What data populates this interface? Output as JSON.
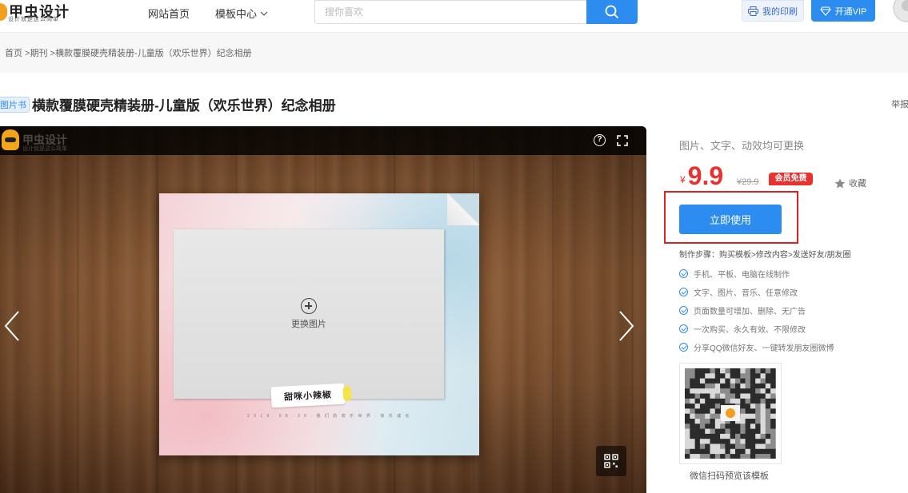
{
  "header": {
    "logo_text": "甲虫设计",
    "logo_sub": "设计就是这么简单",
    "nav_home": "网站首页",
    "nav_templates": "模板中心",
    "search_placeholder": "搜你喜欢",
    "print_label": "我的印刷",
    "vip_label": "开通VIP"
  },
  "breadcrumb": {
    "home": "首页",
    "sep": " >",
    "category": "期刊",
    "current": "横款覆膜硬壳精装册-儿童版（欢乐世界）纪念相册"
  },
  "product": {
    "tag": "图片书",
    "title": "横款覆膜硬壳精装册-儿童版（欢乐世界）纪念相册",
    "report": "举报"
  },
  "preview": {
    "logo_text": "甲虫设计",
    "logo_sub": "设计就是这么简单",
    "help": "?",
    "replace_label": "更换图片",
    "sticker_text": "甜咪小辣椒",
    "tiny_text": "2 0 1 9 · 0 8 · 2 0 · 我 们 的 欢 乐 世 界 · 快 乐 成 长"
  },
  "panel": {
    "subtitle": "图片、文字、动效均可更换",
    "currency": "¥",
    "price": "9.9",
    "original_price": "¥29.9",
    "member_badge": "会员免费",
    "favorite": "收藏",
    "use_button": "立即使用",
    "steps": "制作步骤：购买模板>修改内容>发送好友/朋友圈",
    "features": [
      "手机、平板、电脑在线制作",
      "文字、图片、音乐、任意修改",
      "页面数量可增加、删除、无广告",
      "一次购买、永久有效、不限修改",
      "分享QQ微信好友、一键转发朋友圈微博"
    ],
    "qr_caption": "微信扫码预览该模板"
  },
  "colors": {
    "accent": "#2d8cf0",
    "price": "#e8322f",
    "highlight": "#e02020"
  }
}
